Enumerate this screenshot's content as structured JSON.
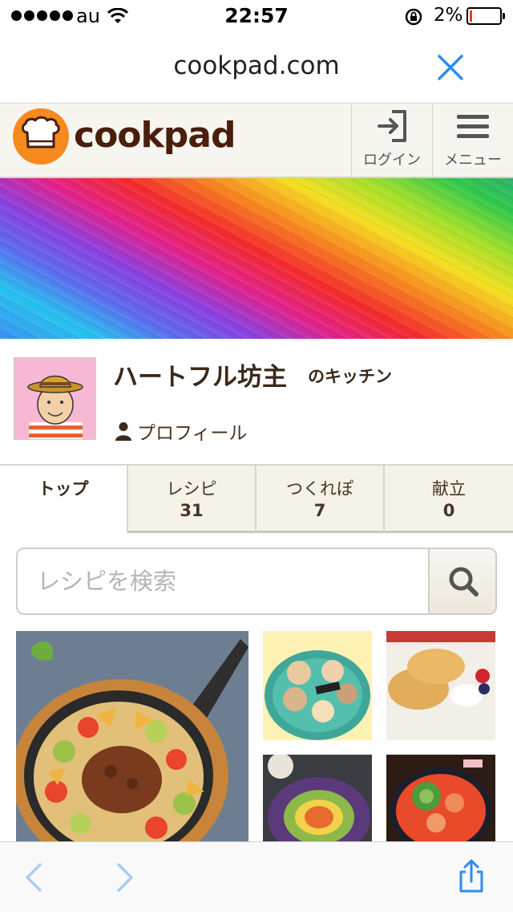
{
  "status_bar": {
    "carrier": "au",
    "time": "22:57",
    "battery_percent": "2%",
    "battery_level": 0.02
  },
  "address_bar": {
    "url": "cookpad.com",
    "close_icon": "close-icon"
  },
  "header": {
    "logo_text": "cookpad",
    "login_label": "ログイン",
    "menu_label": "メニュー"
  },
  "profile": {
    "kitchen_name": "ハートフル坊主",
    "kitchen_suffix": "のキッチン",
    "profile_link": "プロフィール"
  },
  "tabs": [
    {
      "label": "トップ",
      "count": ""
    },
    {
      "label": "レシピ",
      "count": "31"
    },
    {
      "label": "つくれぽ",
      "count": "7"
    },
    {
      "label": "献立",
      "count": "0"
    }
  ],
  "search": {
    "placeholder": "レシピを検索"
  },
  "colors": {
    "brand_orange": "#f58a1f",
    "logo_brown": "#4a1e0c",
    "ios_blue": "#2d8cf0"
  }
}
